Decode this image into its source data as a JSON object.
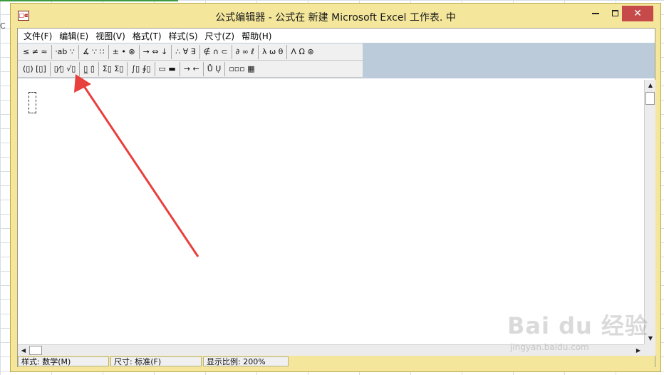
{
  "background": {
    "cell_fragment": "C"
  },
  "window": {
    "title": "公式编辑器 - 公式在 新建 Microsoft Excel 工作表. 中",
    "icon_glyph": "□α",
    "close_glyph": "✕"
  },
  "menu": [
    "文件(F)",
    "编辑(E)",
    "视图(V)",
    "格式(T)",
    "样式(S)",
    "尺寸(Z)",
    "帮助(H)"
  ],
  "toolbar": {
    "row1": [
      "≤ ≠ ≈",
      "⸱ab ∵",
      "∡ ∵ ∷",
      "± • ⊗",
      "→ ⇔ ↓",
      "∴ ∀ ∃",
      "∉ ∩ ⊂",
      "∂ ∞ ℓ",
      "λ ω θ",
      "Λ Ω ⊛"
    ],
    "row2": [
      "(▯) [▯]",
      "▯⁄▯ √▯",
      "▯̲ ▯̇",
      "Σ▯ Σ▯",
      "∫▯ ∮▯",
      "▭ ▬",
      "→ ←",
      "Ů Ụ",
      "▫▫▫ ▦"
    ]
  },
  "scroll": {
    "up": "▲",
    "down": "▼",
    "left": "◀",
    "right": "▶"
  },
  "status": {
    "style": "样式: 数学(M)",
    "size": "尺寸: 标准(F)",
    "zoom": "显示比例: 200%"
  },
  "annotation": {
    "color": "#e8403c"
  },
  "watermark": {
    "brand": "Bai du 经验",
    "url": "jingyan.baidu.com"
  }
}
